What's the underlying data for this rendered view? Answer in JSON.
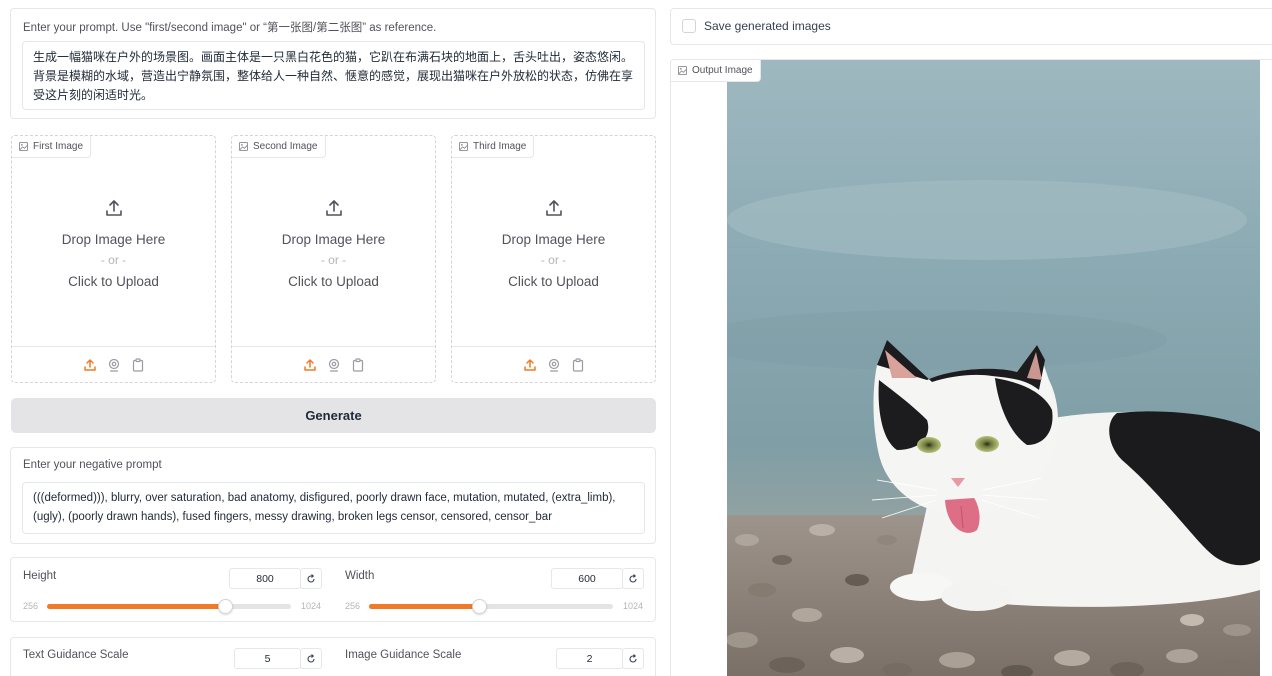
{
  "prompt": {
    "label": "Enter your prompt. Use \"first/second image\" or “第一张图/第二张图” as reference.",
    "value": "生成一幅猫咪在户外的场景图。画面主体是一只黑白花色的猫，它趴在布满石块的地面上，舌头吐出，姿态悠闲。背景是模糊的水域，营造出宁静氛围，整体给人一种自然、惬意的感觉，展现出猫咪在户外放松的状态，仿佛在享受这片刻的闲适时光。"
  },
  "uploads": [
    {
      "tag": "First Image",
      "drop": "Drop Image Here",
      "or": "- or -",
      "click": "Click to Upload"
    },
    {
      "tag": "Second Image",
      "drop": "Drop Image Here",
      "or": "- or -",
      "click": "Click to Upload"
    },
    {
      "tag": "Third Image",
      "drop": "Drop Image Here",
      "or": "- or -",
      "click": "Click to Upload"
    }
  ],
  "generate_label": "Generate",
  "negative": {
    "label": "Enter your negative prompt",
    "value": "(((deformed))), blurry, over saturation, bad anatomy, disfigured, poorly drawn face, mutation, mutated, (extra_limb), (ugly), (poorly drawn hands), fused fingers, messy drawing, broken legs censor, censored, censor_bar"
  },
  "height": {
    "label": "Height",
    "value": "800",
    "min": "256",
    "max": "1024",
    "fraction": 0.73
  },
  "width": {
    "label": "Width",
    "value": "600",
    "min": "256",
    "max": "1024",
    "fraction": 0.45
  },
  "text_guidance": {
    "label": "Text Guidance Scale",
    "value": "5"
  },
  "image_guidance": {
    "label": "Image Guidance Scale",
    "value": "2"
  },
  "save": {
    "label": "Save generated images",
    "checked": false
  },
  "output": {
    "tag": "Output Image"
  },
  "icons": {
    "image": "image-icon",
    "upload": "upload-icon",
    "webcam": "webcam-icon",
    "clipboard": "clipboard-icon",
    "reset": "reset-icon"
  },
  "colors": {
    "accent": "#f07a26",
    "button": "#e4e4e7",
    "border": "#e5e7eb"
  }
}
